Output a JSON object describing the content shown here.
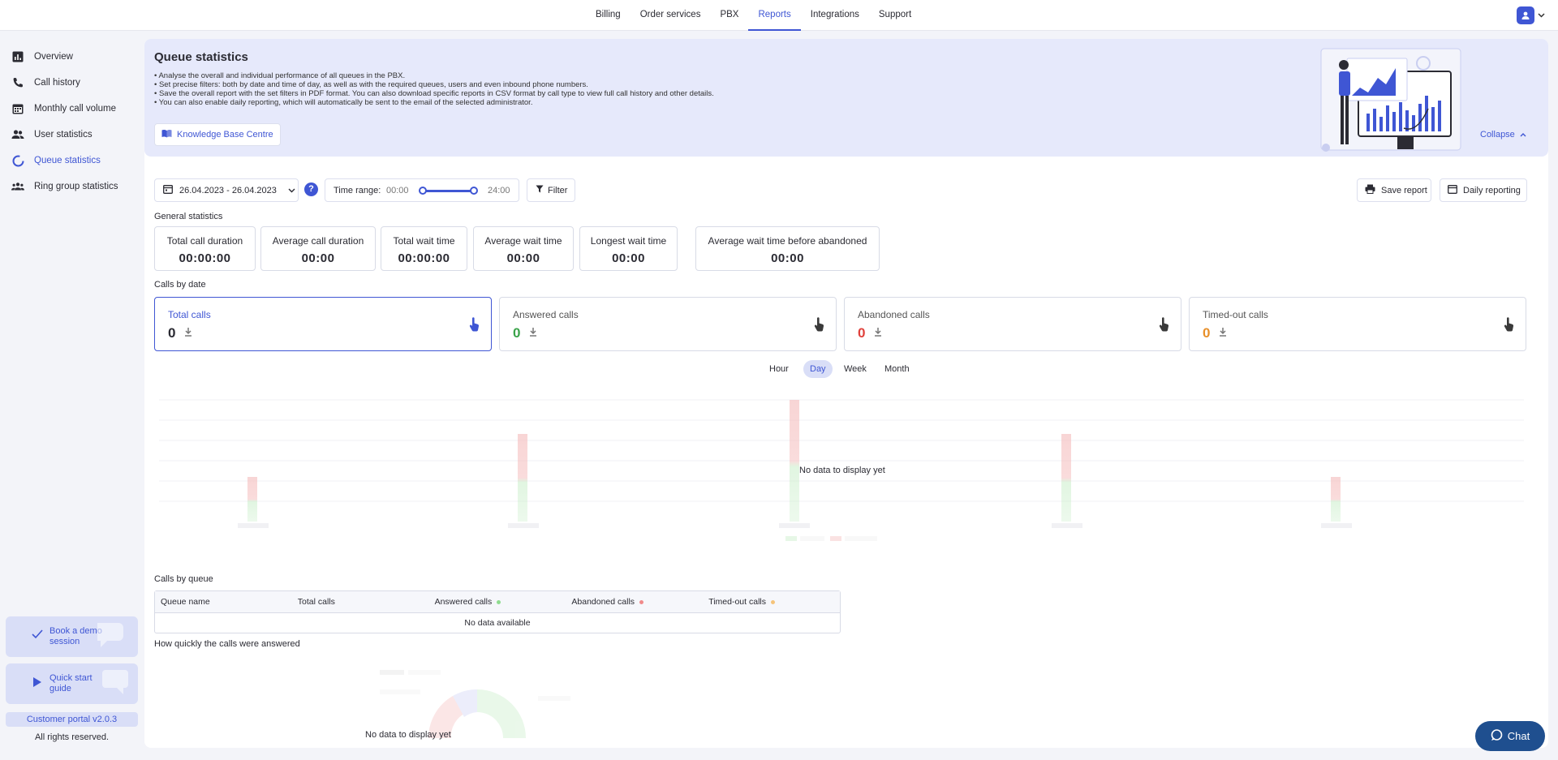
{
  "topnav": {
    "tabs": [
      {
        "label": "Billing"
      },
      {
        "label": "Order services"
      },
      {
        "label": "PBX"
      },
      {
        "label": "Reports",
        "active": true
      },
      {
        "label": "Integrations"
      },
      {
        "label": "Support"
      }
    ]
  },
  "sidebar": {
    "items": [
      {
        "label": "Overview",
        "icon": "bar-chart-icon"
      },
      {
        "label": "Call history",
        "icon": "phone-icon"
      },
      {
        "label": "Monthly call volume",
        "icon": "calendar-icon"
      },
      {
        "label": "User statistics",
        "icon": "users-icon"
      },
      {
        "label": "Queue statistics",
        "icon": "queue-icon",
        "active": true
      },
      {
        "label": "Ring group statistics",
        "icon": "group-icon"
      }
    ],
    "demo_label": "Book a demo session",
    "guide_label": "Quick start guide",
    "version": "Customer portal v2.0.3",
    "rights": "All rights reserved."
  },
  "banner": {
    "title": "Queue statistics",
    "bullets": [
      "Analyse the overall and individual performance of all queues in the PBX.",
      "Set precise filters: both by date and time of day, as well as with the required queues, users and even inbound phone numbers.",
      "Save the overall report with the set filters in PDF format. You can also download specific reports in CSV format by call type to view full call history and other details.",
      "You can also enable daily reporting, which will automatically be sent to the email of the selected administrator."
    ],
    "kb_button": "Knowledge Base Centre",
    "collapse": "Collapse"
  },
  "filters": {
    "date_range": "26.04.2023 - 26.04.2023",
    "help": "?",
    "time_range_label": "Time range:",
    "time_from": "00:00",
    "time_to": "24:00",
    "filter_button": "Filter",
    "save_report": "Save report",
    "daily_reporting": "Daily reporting"
  },
  "general": {
    "heading": "General statistics",
    "stats": [
      {
        "title": "Total call duration",
        "value": "00:00:00"
      },
      {
        "title": "Average call duration",
        "value": "00:00"
      },
      {
        "title": "Total wait time",
        "value": "00:00:00"
      },
      {
        "title": "Average wait time",
        "value": "00:00"
      },
      {
        "title": "Longest wait time",
        "value": "00:00"
      },
      {
        "title": "Average wait time before abandoned",
        "value": "00:00"
      }
    ]
  },
  "calls_by_date": {
    "heading": "Calls by date",
    "cards": [
      {
        "title": "Total calls",
        "value": "0",
        "color": "#2b2b33"
      },
      {
        "title": "Answered calls",
        "value": "0",
        "color": "#3aa34a"
      },
      {
        "title": "Abandoned calls",
        "value": "0",
        "color": "#e0413c"
      },
      {
        "title": "Timed-out calls",
        "value": "0",
        "color": "#e8902a"
      }
    ],
    "periods": [
      "Hour",
      "Day",
      "Week",
      "Month"
    ],
    "active_period": "Day",
    "no_data": "No data to display yet"
  },
  "calls_by_queue": {
    "heading": "Calls by queue",
    "columns": [
      "Queue name",
      "Total calls",
      "Answered calls",
      "Abandoned calls",
      "Timed-out calls"
    ],
    "empty": "No data available"
  },
  "answer_speed": {
    "heading": "How quickly the calls were answered",
    "no_data": "No data to display yet"
  },
  "chat": {
    "label": "Chat"
  },
  "colors": {
    "accent": "#3f56d4",
    "answered": "#3aa34a",
    "abandoned": "#e0413c",
    "timed_out": "#e8902a"
  }
}
